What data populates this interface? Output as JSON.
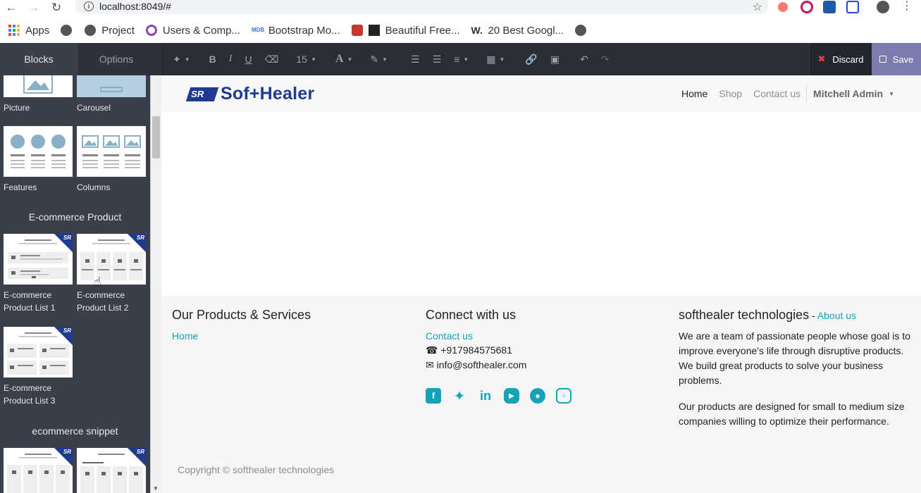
{
  "browser": {
    "url": "localhost:8049/#",
    "bookmarks": [
      "Apps",
      "Project",
      "Users & Comp...",
      "Bootstrap Mo...",
      "Beautiful Free...",
      "20 Best Googl..."
    ]
  },
  "sidebar": {
    "tabs": [
      "Blocks",
      "Options"
    ],
    "blocks_top": [
      "Picture",
      "Carousel",
      "Features",
      "Columns"
    ],
    "section_ecommerce_product": "E-commerce Product",
    "ecommerce_blocks": [
      "E-commerce Product List 1",
      "E-commerce Product List 2",
      "E-commerce Product List 3"
    ],
    "section_ecommerce_snippet": "ecommerce snippet",
    "badge": "SR"
  },
  "toolbar": {
    "font_size": "15",
    "discard_label": "Discard",
    "save_label": "Save"
  },
  "site": {
    "logo_text": "Sof+Healer",
    "logo_mark": "SR",
    "menu": [
      "Home",
      "Shop",
      "Contact us"
    ],
    "user": "Mitchell Admin"
  },
  "footer": {
    "col1_title": "Our Products & Services",
    "col1_link": "Home",
    "col2_title": "Connect with us",
    "col2_link": "Contact us",
    "phone": "+917984575681",
    "email": "info@softhealer.com",
    "col3_title": "softhealer technologies",
    "col3_dash": " - ",
    "col3_link": "About us",
    "about_p1": "We are a team of passionate people whose goal is to improve everyone's life through disruptive products. We build great products to solve your business problems.",
    "about_p2": "Our products are designed for small to medium size companies willing to optimize their performance.",
    "copyright": "Copyright © softhealer technologies"
  },
  "colors": {
    "brand": "#1f3b8f",
    "link": "#17a2b8",
    "sidebar": "#3b3f4a",
    "toolbar": "#2b2d35",
    "save": "#7c7bad"
  }
}
